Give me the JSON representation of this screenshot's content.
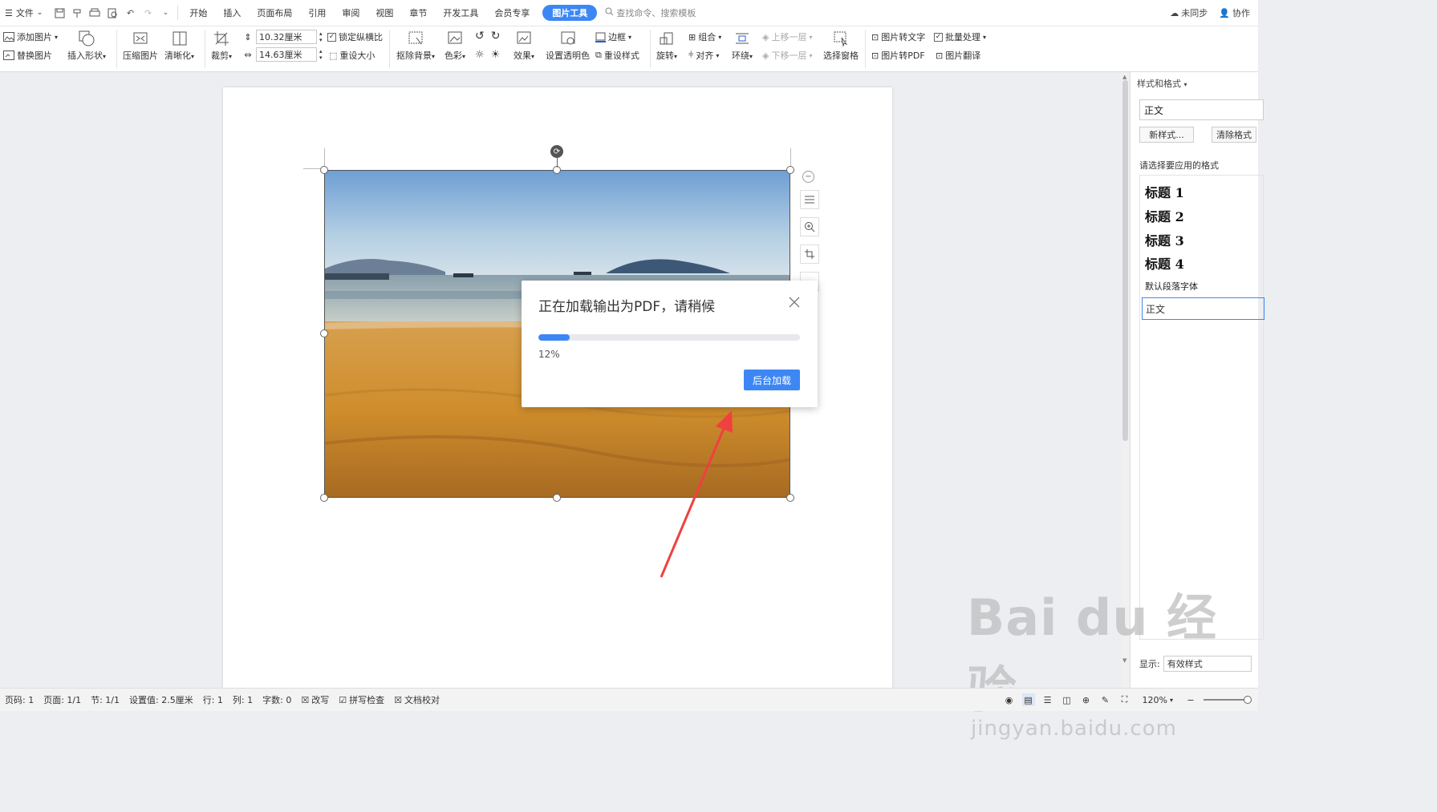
{
  "menubar": {
    "file_label": "文件",
    "tabs": [
      "开始",
      "插入",
      "页面布局",
      "引用",
      "审阅",
      "视图",
      "章节",
      "开发工具",
      "会员专享"
    ],
    "active_tab": "图片工具",
    "search_text": "查找命令、搜索模板",
    "sync_label": "未同步",
    "collab_label": "协作"
  },
  "ribbon": {
    "add_picture": "添加图片",
    "replace_picture": "替换图片",
    "insert_shape": "插入形状",
    "compress_picture": "压缩图片",
    "sharpen": "清晰化",
    "crop": "裁剪",
    "height_value": "10.32厘米",
    "width_value": "14.63厘米",
    "lock_ratio": "锁定纵横比",
    "reset_size": "重设大小",
    "remove_bg": "抠除背景",
    "color": "色彩",
    "effects": "效果",
    "set_transparent": "设置透明色",
    "border": "边框",
    "reset_style": "重设样式",
    "rotate": "旋转",
    "group": "组合",
    "align": "对齐",
    "wrap": "环绕",
    "bring_forward": "上移一层",
    "send_backward": "下移一层",
    "selection_pane": "选择窗格",
    "pic_to_text": "图片转文字",
    "batch_process": "批量处理",
    "pic_to_pdf": "图片转PDF",
    "pic_translate": "图片翻译"
  },
  "dialog": {
    "title": "正在加载输出为PDF，请稍候",
    "progress_text": "12%",
    "progress": 0.12,
    "button": "后台加载"
  },
  "sidepanel": {
    "title": "样式和格式",
    "current_style": "正文",
    "new_style": "新样式...",
    "clear_format": "清除格式",
    "apply_label": "请选择要应用的格式",
    "headings": [
      "标题 1",
      "标题 2",
      "标题 3",
      "标题 4"
    ],
    "default_font": "默认段落字体",
    "body_style": "正文",
    "show_label": "显示:",
    "show_value": "有效样式"
  },
  "watermark": {
    "main": "Bai du 经验",
    "sub": "jingyan.baidu.com"
  },
  "statusbar": {
    "page_no": "页码: 1",
    "pages": "页面: 1/1",
    "section": "节: 1/1",
    "setting": "设置值: 2.5厘米",
    "row": "行: 1",
    "col": "列: 1",
    "words": "字数: 0",
    "revise": "改写",
    "spell": "拼写检查",
    "proof": "文档校对",
    "zoom": "120%"
  },
  "colors": {
    "accent": "#3d87f5",
    "arrow": "#f04040"
  }
}
